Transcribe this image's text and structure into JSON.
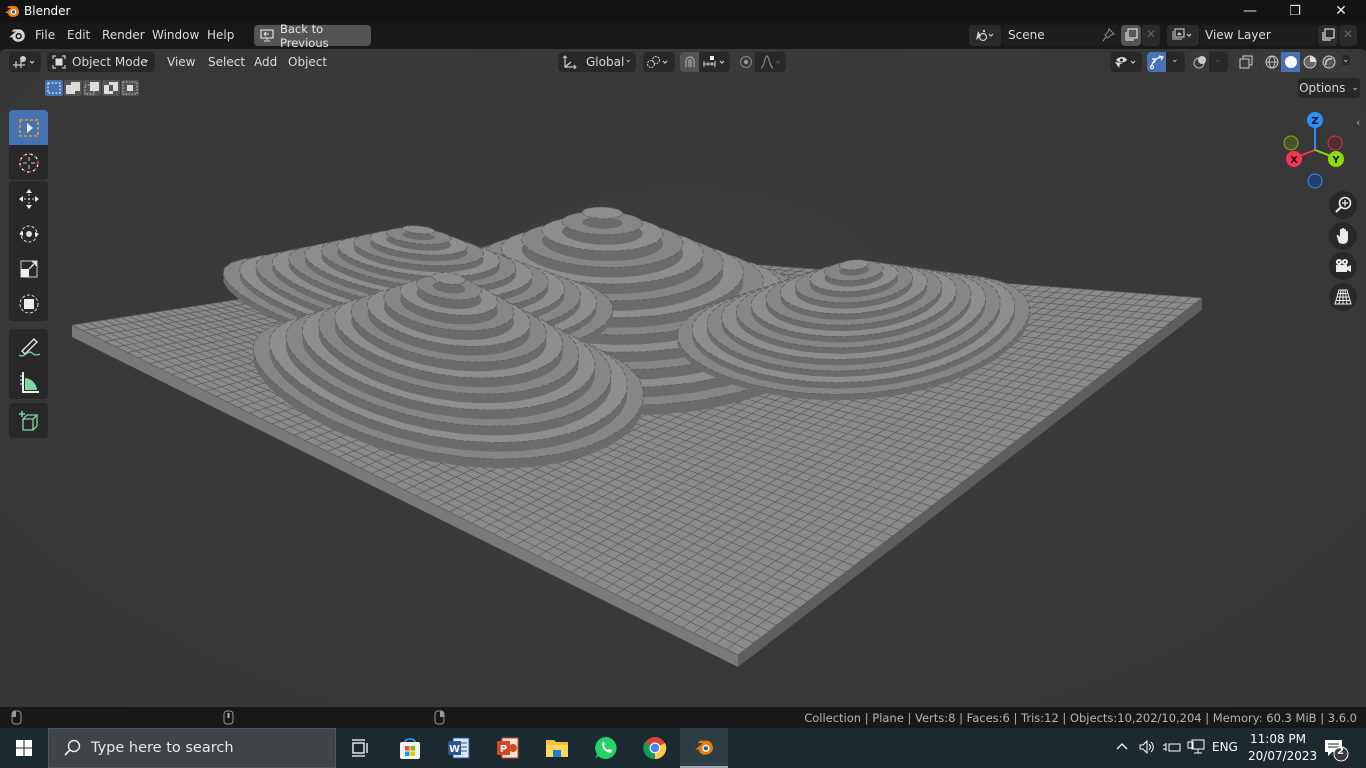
{
  "window": {
    "title": "Blender",
    "controls": {
      "minimize": "—",
      "maximize": "❐",
      "close": "✕"
    }
  },
  "menubar": {
    "items": [
      "File",
      "Edit",
      "Render",
      "Window",
      "Help"
    ],
    "back_button": "Back to Previous",
    "scene": {
      "label": "Scene",
      "icon": "scene-icon"
    },
    "view_layer": {
      "label": "View Layer",
      "icon": "view-layer-icon"
    }
  },
  "viewport_header": {
    "mode": "Object Mode",
    "menus": [
      "View",
      "Select",
      "Add",
      "Object"
    ],
    "transform_orientation": "Global",
    "options_label": "Options",
    "selection_modes": [
      "set-new",
      "extend",
      "subtract",
      "invert",
      "intersect"
    ],
    "shading_modes": [
      "wireframe",
      "solid",
      "material-preview",
      "rendered"
    ],
    "active_shading": "solid"
  },
  "toolbar": {
    "tools": [
      {
        "name": "select-box",
        "icon": "select-box-icon",
        "active": true
      },
      {
        "name": "cursor",
        "icon": "cursor-icon",
        "active": false
      },
      {
        "name": "move",
        "icon": "move-icon",
        "active": false
      },
      {
        "name": "rotate",
        "icon": "rotate-icon",
        "active": false
      },
      {
        "name": "scale",
        "icon": "scale-icon",
        "active": false
      },
      {
        "name": "transform",
        "icon": "transform-icon",
        "active": false
      },
      {
        "name": "annotate",
        "icon": "annotate-icon",
        "active": false
      },
      {
        "name": "measure",
        "icon": "measure-icon",
        "active": false
      },
      {
        "name": "add-cube",
        "icon": "add-cube-icon",
        "active": false
      }
    ]
  },
  "gizmo": {
    "axes": {
      "x": "X",
      "y": "Y",
      "z": "Z"
    },
    "colors": {
      "x": "#ff3352",
      "y": "#8bdc00",
      "z": "#2890ff"
    }
  },
  "navigation": [
    "zoom",
    "pan",
    "camera",
    "perspective-ortho"
  ],
  "statusbar": {
    "stats": "Collection | Plane | Verts:8 | Faces:6 | Tris:12 | Objects:10,202/10,204 | Memory: 60.3 MiB | 3.6.0"
  },
  "taskbar": {
    "search_placeholder": "Type here to search",
    "apps": [
      "Task View",
      "Microsoft Store",
      "Word",
      "PowerPoint",
      "File Explorer",
      "WhatsApp",
      "Chrome",
      "Blender"
    ],
    "tray": {
      "language": "ENG",
      "time": "11:08 PM",
      "date": "20/07/2023",
      "notifications": "2"
    }
  },
  "colors": {
    "accent": "#4772b3",
    "viewport_bg": "#393939",
    "voxel": "#8a8a8a"
  }
}
